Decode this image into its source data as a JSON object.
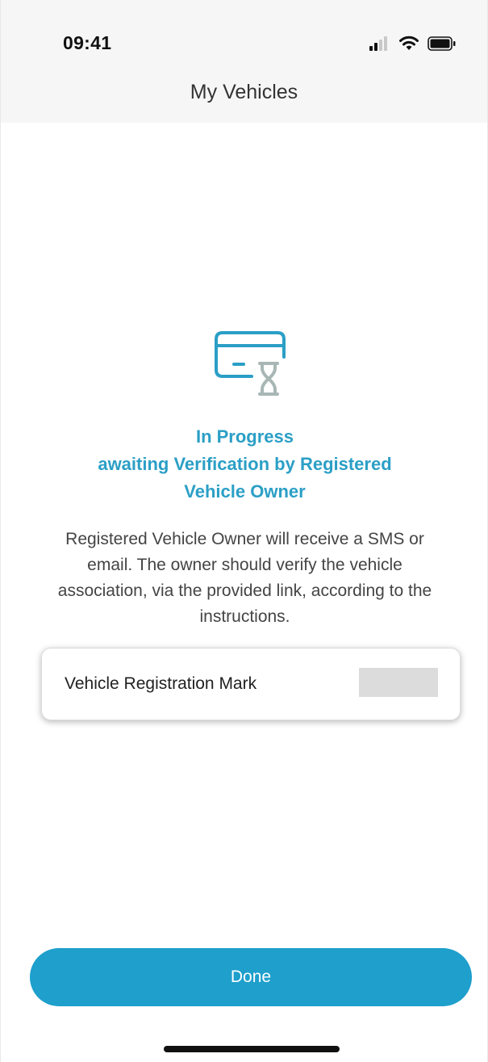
{
  "status_bar": {
    "time": "09:41",
    "icons": [
      "signal-icon",
      "wifi-icon",
      "battery-icon"
    ]
  },
  "header": {
    "title": "My Vehicles"
  },
  "status": {
    "icon": "card-hourglass-icon",
    "title_lines": [
      "In Progress",
      "awaiting Verification by Registered",
      "Vehicle Owner"
    ],
    "description": "Registered Vehicle Owner will receive a SMS or email. The owner should verify the vehicle association, via the provided link, according to the instructions."
  },
  "vehicle_card": {
    "label": "Vehicle Registration Mark",
    "value": ""
  },
  "actions": {
    "done_label": "Done"
  },
  "colors": {
    "accent": "#1e9fcc",
    "title_text": "#2b9fc6",
    "icon_gray": "#a8b7b5",
    "top_bar_bg": "#f6f6f6"
  }
}
